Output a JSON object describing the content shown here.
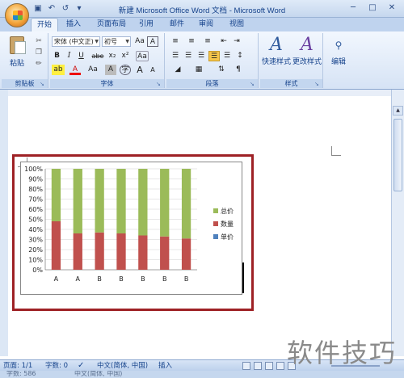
{
  "window": {
    "title": "新建 Microsoft Office Word 文档 - Microsoft Word",
    "min_icon": "minimize-icon",
    "max_icon": "maximize-icon",
    "close_icon": "close-icon"
  },
  "qat": {
    "save": "save-icon",
    "undo": "undo-icon",
    "redo": "redo-icon",
    "more": "customize-icon"
  },
  "tabs": [
    "开始",
    "插入",
    "页面布局",
    "引用",
    "邮件",
    "审阅",
    "视图"
  ],
  "active_tab": "开始",
  "ribbon": {
    "clipboard": {
      "label": "剪贴板",
      "paste": "粘贴"
    },
    "font": {
      "label": "字体",
      "font_name": "宋体 (中文正)",
      "font_size": "初号",
      "bold": "B",
      "italic": "I",
      "underline": "U",
      "strike": "abe",
      "subscript": "x₂",
      "superscript": "x²",
      "clear": "Aa",
      "char_border": "A",
      "highlight": "ab",
      "font_color": "A",
      "shading": "A",
      "change_case": "Aa",
      "grow": "A",
      "shrink": "A"
    },
    "paragraph": {
      "label": "段落"
    },
    "styles": {
      "label": "样式",
      "quick_styles": "快速样式",
      "change_styles": "更改样式"
    },
    "editing": {
      "label": "编辑"
    }
  },
  "chart_data": {
    "type": "bar",
    "stacked_percent": true,
    "categories": [
      "A",
      "A",
      "B",
      "B",
      "B",
      "B",
      "B"
    ],
    "series": [
      {
        "name": "单价",
        "color": "#4f81bd",
        "values": [
          0,
          0,
          0,
          0,
          0,
          0,
          0
        ]
      },
      {
        "name": "数量",
        "color": "#c0504d",
        "values": [
          48,
          36,
          37,
          36,
          34,
          33,
          31
        ]
      },
      {
        "name": "总价",
        "color": "#9bbb59",
        "values": [
          52,
          64,
          63,
          64,
          66,
          67,
          69
        ]
      }
    ],
    "yticks": [
      "0%",
      "10%",
      "20%",
      "30%",
      "40%",
      "50%",
      "60%",
      "70%",
      "80%",
      "90%",
      "100%"
    ],
    "ylim": [
      0,
      100
    ],
    "legend": [
      "总价",
      "数量",
      "单价"
    ],
    "legend_position": "right",
    "grid": true
  },
  "status": {
    "page": "页面: 1/1",
    "words": "字数: 0",
    "lang": "中文(简体, 中国)",
    "mode": "插入",
    "row2_words": "字数: 586",
    "row2_lang": "中文(简体, 中国)"
  },
  "watermark": "软件技巧"
}
